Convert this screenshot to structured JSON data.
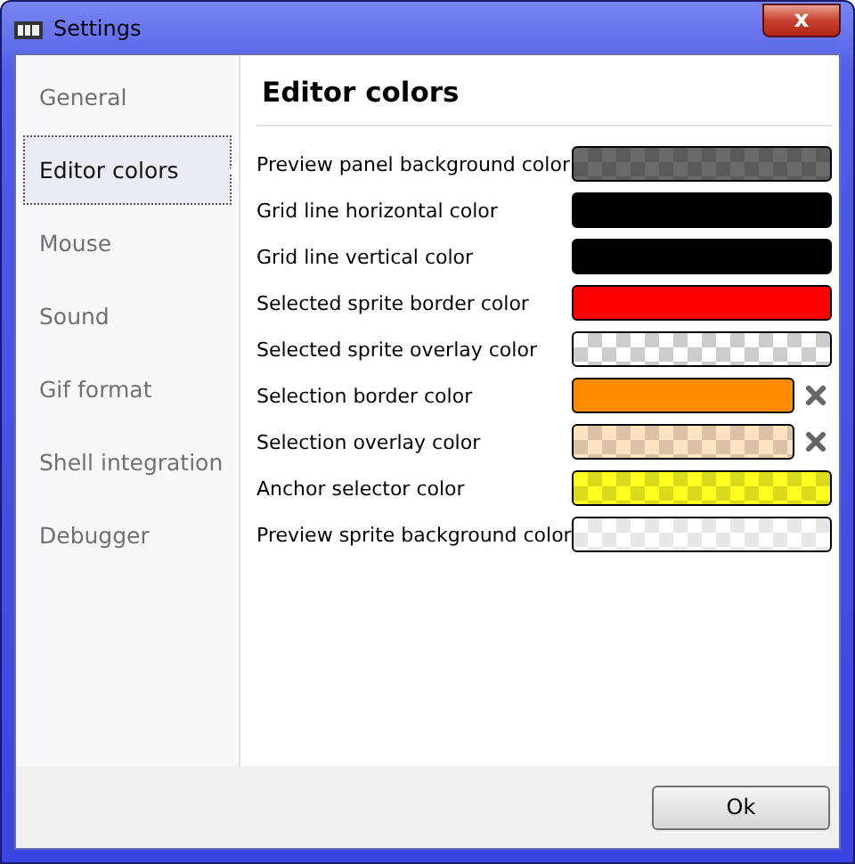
{
  "window": {
    "title": "Settings",
    "close": "x"
  },
  "sidebar": {
    "items": [
      {
        "label": "General",
        "selected": false
      },
      {
        "label": "Editor colors",
        "selected": true
      },
      {
        "label": "Mouse",
        "selected": false
      },
      {
        "label": "Sound",
        "selected": false
      },
      {
        "label": "Gif format",
        "selected": false
      },
      {
        "label": "Shell integration",
        "selected": false
      },
      {
        "label": "Debugger",
        "selected": false
      }
    ]
  },
  "page": {
    "title": "Editor colors",
    "settings": [
      {
        "label": "Preview panel background color",
        "kind": "checker",
        "color": "#6a6a6a",
        "clearable": false
      },
      {
        "label": "Grid line horizontal color",
        "kind": "solid",
        "color": "#000000",
        "clearable": false
      },
      {
        "label": "Grid line vertical color",
        "kind": "solid",
        "color": "#000000",
        "clearable": false
      },
      {
        "label": "Selected sprite border color",
        "kind": "solid",
        "color": "#ff0000",
        "clearable": false
      },
      {
        "label": "Selected sprite overlay color",
        "kind": "transparent",
        "color": "#cccccc",
        "clearable": false
      },
      {
        "label": "Selection border color",
        "kind": "solid",
        "color": "#ff8c00",
        "clearable": true
      },
      {
        "label": "Selection overlay color",
        "kind": "checker",
        "color": "#fde2c2",
        "clearable": true
      },
      {
        "label": "Anchor selector color",
        "kind": "checker",
        "color": "#ffff22",
        "clearable": false
      },
      {
        "label": "Preview sprite background color",
        "kind": "transparent",
        "color": "#e6e6e6",
        "clearable": false
      }
    ]
  },
  "buttons": [
    "Ok"
  ]
}
